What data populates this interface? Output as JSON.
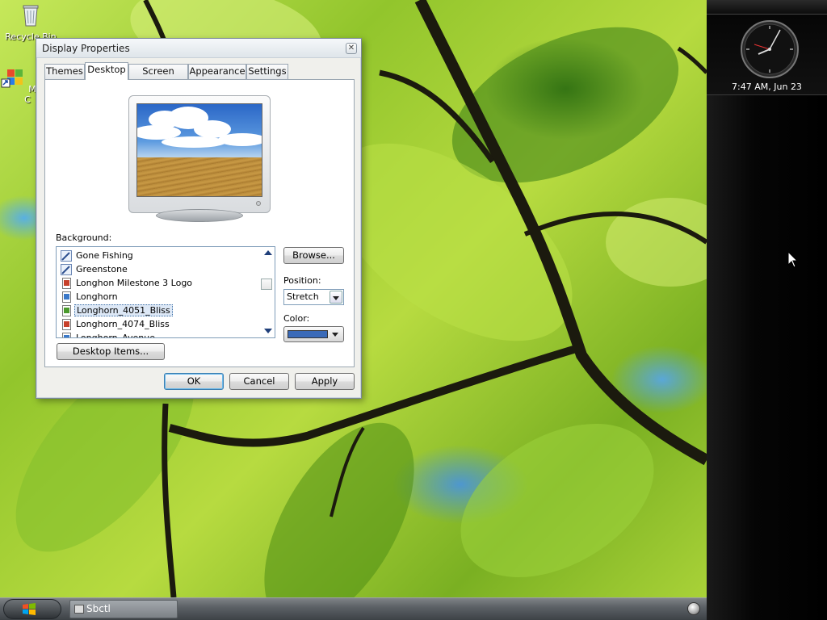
{
  "desktop": {
    "icons": [
      {
        "label": "Recycle Bin",
        "icon": "recycle-bin-icon"
      },
      {
        "label": "Media C",
        "icon": "media-center-icon"
      }
    ]
  },
  "sidebar": {
    "clock_text": "7:47 AM, Jun 23"
  },
  "taskbar": {
    "task_label": "Sbctl"
  },
  "dialog": {
    "title": "Display Properties",
    "close_glyph": "✕",
    "tabs": [
      {
        "label": "Themes",
        "active": false
      },
      {
        "label": "Desktop",
        "active": true
      },
      {
        "label": "Screen Saver",
        "active": false
      },
      {
        "label": "Appearance",
        "active": false
      },
      {
        "label": "Settings",
        "active": false
      }
    ],
    "background_label": "Background:",
    "background_items": [
      {
        "label": "Gone Fishing",
        "icon": "brush-icon",
        "selected": false
      },
      {
        "label": "Greenstone",
        "icon": "brush-icon",
        "selected": false
      },
      {
        "label": "Longhon Milestone 3 Logo",
        "icon": "image-file-icon",
        "selected": false
      },
      {
        "label": "Longhorn",
        "icon": "image-file-icon",
        "selected": false
      },
      {
        "label": "Longhorn_4051_Bliss",
        "icon": "image-file-icon",
        "selected": true
      },
      {
        "label": "Longhorn_4074_Bliss",
        "icon": "image-file-icon",
        "selected": false
      },
      {
        "label": "Longhorn_Avenue",
        "icon": "image-file-icon",
        "selected": false
      }
    ],
    "browse_label": "Browse...",
    "position_label": "Position:",
    "position_value": "Stretch",
    "color_label": "Color:",
    "color_value": "#3a6ab8",
    "desktop_items_label": "Desktop Items...",
    "ok_label": "OK",
    "cancel_label": "Cancel",
    "apply_label": "Apply"
  }
}
